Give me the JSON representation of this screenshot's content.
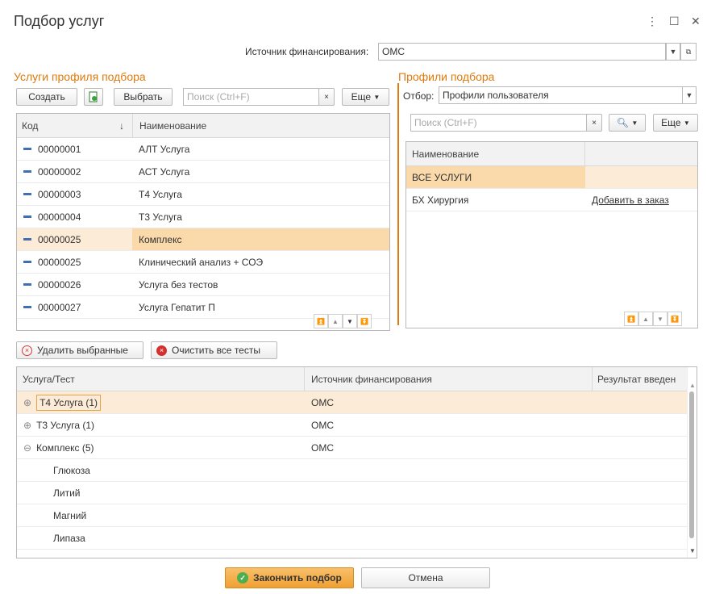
{
  "window": {
    "title": "Подбор услуг"
  },
  "funding": {
    "label": "Источник финансирования:",
    "value": "ОМС"
  },
  "left": {
    "title": "Услуги профиля подбора",
    "create_label": "Создать",
    "select_label": "Выбрать",
    "search_placeholder": "Поиск (Ctrl+F)",
    "more_label": "Еще",
    "col_code": "Код",
    "col_name": "Наименование",
    "rows": [
      {
        "code": "00000001",
        "name": "АЛТ Услуга"
      },
      {
        "code": "00000002",
        "name": "АСТ Услуга"
      },
      {
        "code": "00000003",
        "name": "Т4 Услуга"
      },
      {
        "code": "00000004",
        "name": "Т3 Услуга"
      },
      {
        "code": "00000025",
        "name": "Комплекс"
      },
      {
        "code": "00000025",
        "name": "Клинический анализ + СОЭ"
      },
      {
        "code": "00000026",
        "name": "Услуга без тестов"
      },
      {
        "code": "00000027",
        "name": "Услуга Гепатит П"
      }
    ]
  },
  "right": {
    "title": "Профили подбора",
    "filter_label": "Отбор:",
    "filter_value": "Профили пользователя",
    "search_placeholder": "Поиск (Ctrl+F)",
    "more_label": "Еще",
    "col_name": "Наименование",
    "rows": [
      {
        "name": "ВСЕ УСЛУГИ",
        "action": ""
      },
      {
        "name": "БХ Хирургия",
        "action": "Добавить в заказ"
      }
    ]
  },
  "actions": {
    "delete_selected": "Удалить выбранные",
    "clear_tests": "Очистить все тесты"
  },
  "bottom": {
    "col_service": "Услуга/Тест",
    "col_funding": "Источник финансирования",
    "col_result": "Результат введен",
    "rows": [
      {
        "name": "Т4 Услуга (1)",
        "funding": "ОМС",
        "marker": "⊕"
      },
      {
        "name": "Т3 Услуга (1)",
        "funding": "ОМС",
        "marker": "⊕"
      },
      {
        "name": "Комплекс (5)",
        "funding": "ОМС",
        "marker": "⊖"
      },
      {
        "name": "Глюкоза",
        "funding": "",
        "marker": ""
      },
      {
        "name": "Литий",
        "funding": "",
        "marker": ""
      },
      {
        "name": "Магний",
        "funding": "",
        "marker": ""
      },
      {
        "name": "Липаза",
        "funding": "",
        "marker": ""
      }
    ]
  },
  "footer": {
    "finish_label": "Закончить подбор",
    "cancel_label": "Отмена"
  },
  "colors": {
    "accent": "#e07b0e",
    "selection": "#fad9ab",
    "finish_button": "#f2a93b",
    "item_marker": "#3f6fb5"
  }
}
